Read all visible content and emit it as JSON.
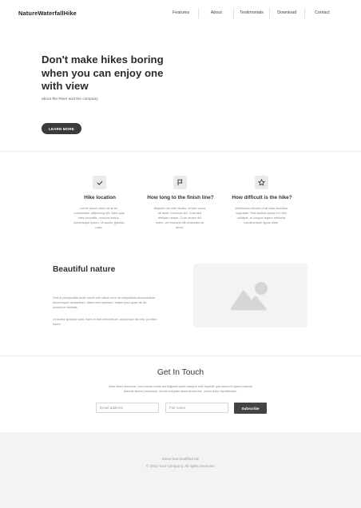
{
  "header": {
    "brand": "NatureWaterfallHike",
    "nav": [
      "Features",
      "About",
      "Testimonials",
      "Download",
      "Contact"
    ]
  },
  "hero": {
    "title": "Don't make hikes boring when you can enjoy one with view",
    "subtitle": "about the River and the company",
    "cta": "LEARN MORE"
  },
  "features": [
    {
      "icon": "check-icon",
      "title": "Hike location",
      "text": "Lorem ipsum dolor sit amet, consectetur adipiscing elit. Nam quis felis convallis, rhoncus lectus, scelerisque ipsum. Ut auctor gravida nulla."
    },
    {
      "icon": "flag-icon",
      "title": "How long to the finish line?",
      "text": "Aliquam vel nibh iaculis, ornare purus sit amet, euismod dui. Cras sed tristique neque. Cras ornare dui lorem, vel rhoncus elit venenatis sit amet."
    },
    {
      "icon": "star-icon",
      "title": "How difficult is the hike?",
      "text": "Vestibulum ultricies erat vitae faucibus vulputate. Sed facilisis ipsum mi nibh volutpat, at congue tegere vehicula condimentum ligula vitae."
    }
  ],
  "nature": {
    "title": "Beautiful nature",
    "paragraph1": "Sed ut perspiciatis unde omnis iste natus error sit voluptatem accusantium doloremque laudantium, totam rem aperiam, eaque ipsa quae ab illo inventore veritatis.",
    "paragraph2": "Ut auctor gravida nulla. Nam et erat elementum, accumsan dui nisi, porttitor lorem.",
    "image_icon": "image-placeholder-icon"
  },
  "contact": {
    "title": "Get In Touch",
    "text": "Nam libero tempore, cum soluta nobis est eligendi optio cumque nihil impedit quo minus id quod maxime placeat facere possimus, omnis voluptas assumenda est, omnis dolor repellendus.",
    "email_placeholder": "Email address",
    "name_placeholder": "Full name",
    "subscribe": "Subscribe"
  },
  "footer": {
    "line1": "Some last modified etc",
    "line2": "© 2021 Your Company. All rights reserved."
  }
}
